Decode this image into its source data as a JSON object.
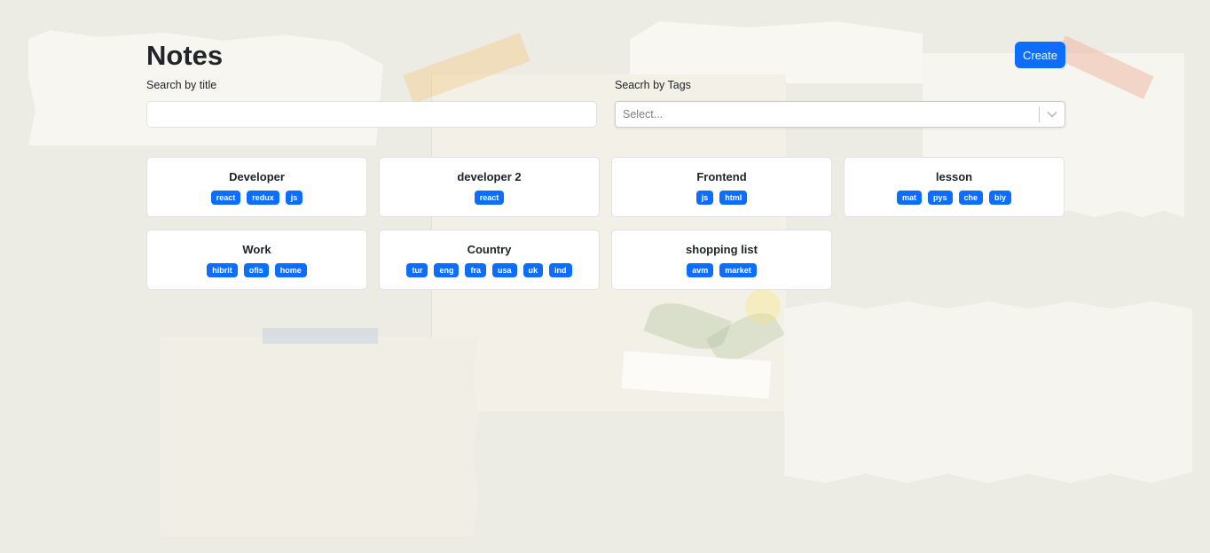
{
  "header": {
    "title": "Notes",
    "create_label": "Create"
  },
  "filters": {
    "title_label": "Search by title",
    "title_value": "",
    "tags_label": "Seacrh by Tags",
    "tags_placeholder": "Select..."
  },
  "notes": [
    {
      "title": "Developer",
      "tags": [
        "react",
        "redux",
        "js"
      ]
    },
    {
      "title": "developer 2",
      "tags": [
        "react"
      ]
    },
    {
      "title": "Frontend",
      "tags": [
        "js",
        "html"
      ]
    },
    {
      "title": "lesson",
      "tags": [
        "mat",
        "pys",
        "che",
        "biy"
      ]
    },
    {
      "title": "Work",
      "tags": [
        "hibrit",
        "ofis",
        "home"
      ]
    },
    {
      "title": "Country",
      "tags": [
        "tur",
        "eng",
        "fra",
        "usa",
        "uk",
        "ind"
      ]
    },
    {
      "title": "shopping list",
      "tags": [
        "avm",
        "market"
      ]
    }
  ],
  "colors": {
    "primary": "#0d6efd",
    "card_bg": "#ffffff",
    "page_bg": "#ecebe4"
  },
  "icons": {
    "select_indicator": "chevron-down-icon"
  }
}
